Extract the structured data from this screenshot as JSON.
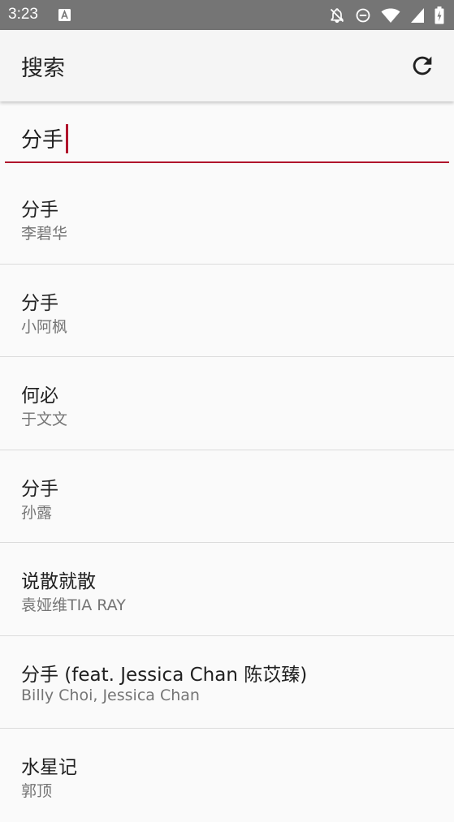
{
  "status_bar": {
    "time": "3:23",
    "icons": [
      "notification-a-icon",
      "notifications-off-icon",
      "do-not-disturb-icon",
      "wifi-icon",
      "cell-signal-icon",
      "battery-icon"
    ]
  },
  "app_bar": {
    "title": "搜索",
    "refresh_icon": "refresh-icon"
  },
  "search": {
    "value": "分手"
  },
  "colors": {
    "accent": "#b0142c",
    "status_bar": "#757575",
    "app_bar": "#f5f5f5",
    "background": "#fafafa"
  },
  "results": [
    {
      "title": "分手",
      "artist": "李碧华"
    },
    {
      "title": "分手",
      "artist": "小阿枫"
    },
    {
      "title": "何必",
      "artist": "于文文"
    },
    {
      "title": "分手",
      "artist": "孙露"
    },
    {
      "title": "说散就散",
      "artist": "袁娅维TIA RAY"
    },
    {
      "title": "分手 (feat. Jessica Chan 陈苡臻)",
      "artist": "Billy Choi, Jessica Chan"
    },
    {
      "title": "水星记",
      "artist": "郭顶"
    }
  ]
}
